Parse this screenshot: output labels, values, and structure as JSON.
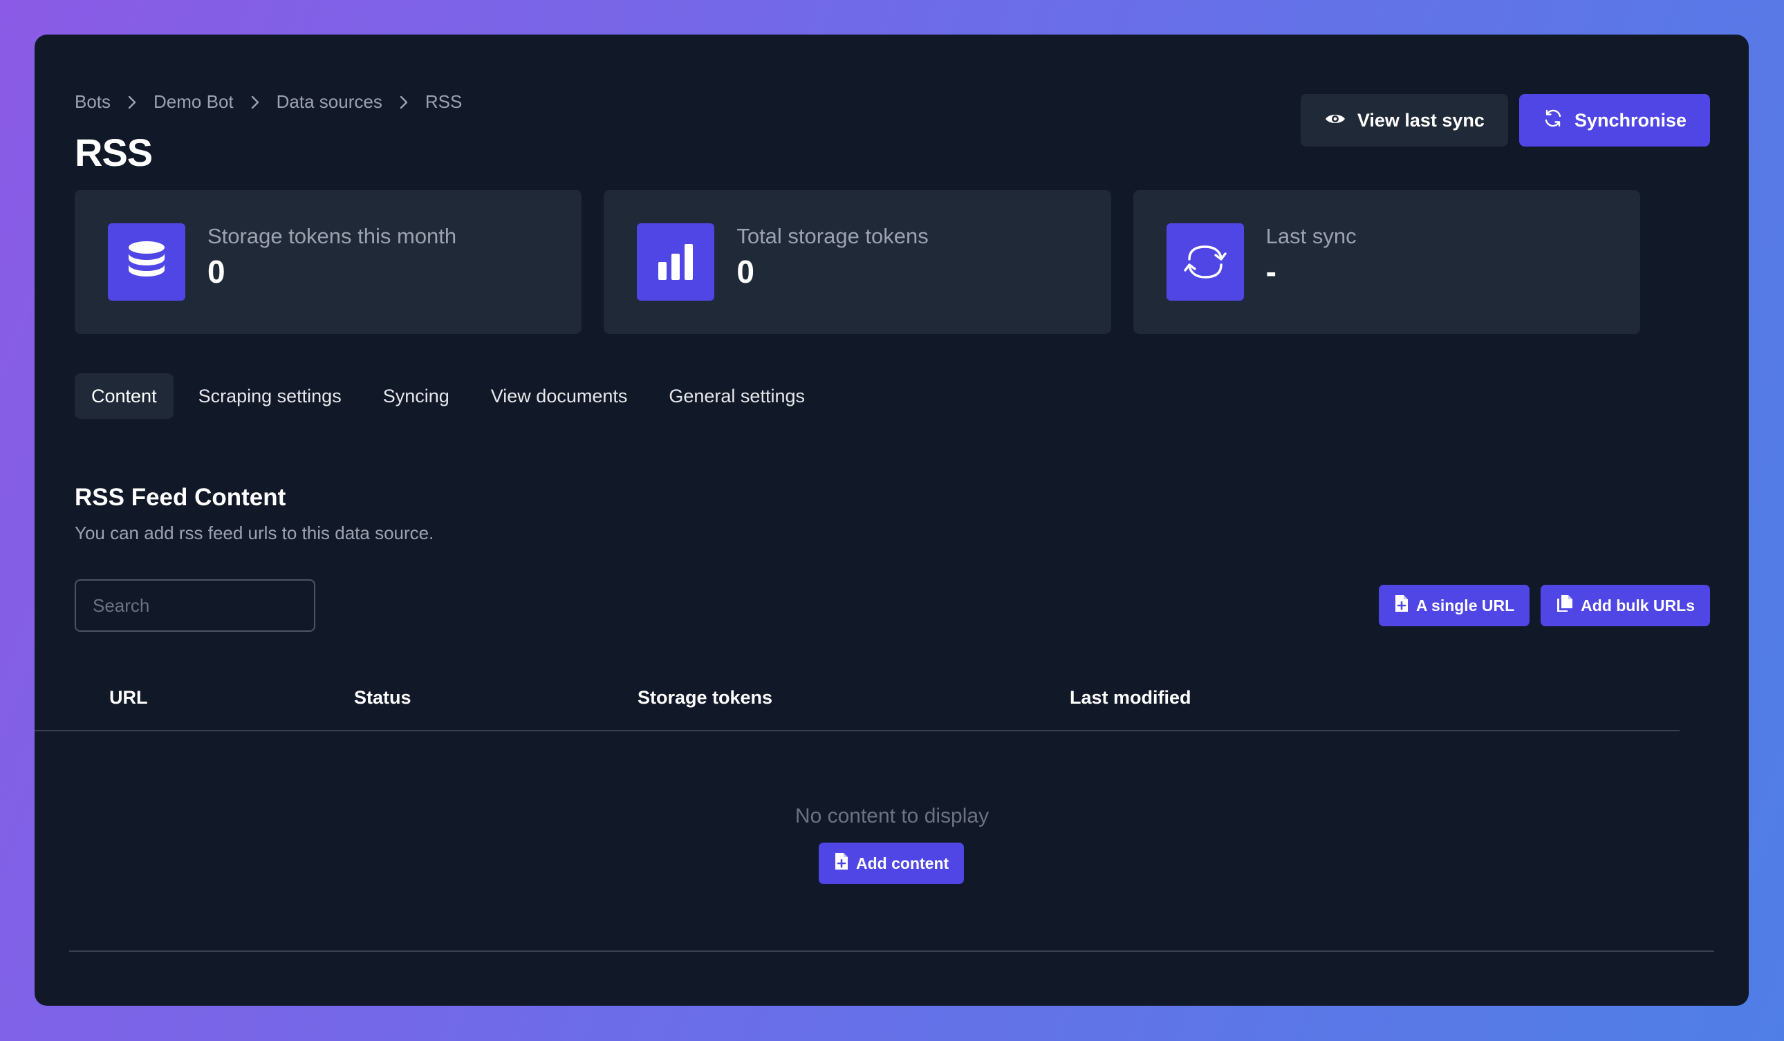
{
  "breadcrumb": [
    {
      "label": "Bots"
    },
    {
      "label": "Demo Bot"
    },
    {
      "label": "Data sources"
    },
    {
      "label": "RSS"
    }
  ],
  "page": {
    "title": "RSS"
  },
  "actions": {
    "view_last_sync": {
      "label": "View last sync",
      "icon": "eye-icon"
    },
    "synchronise": {
      "label": "Synchronise",
      "icon": "refresh-icon"
    }
  },
  "stats": [
    {
      "label": "Storage tokens this month",
      "value": "0",
      "icon": "database-icon"
    },
    {
      "label": "Total storage tokens",
      "value": "0",
      "icon": "bar-chart-icon"
    },
    {
      "label": "Last sync",
      "value": "-",
      "icon": "sync-icon"
    }
  ],
  "tabs": [
    {
      "label": "Content",
      "active": true
    },
    {
      "label": "Scraping settings",
      "active": false
    },
    {
      "label": "Syncing",
      "active": false
    },
    {
      "label": "View documents",
      "active": false
    },
    {
      "label": "General settings",
      "active": false
    }
  ],
  "section": {
    "title": "RSS Feed Content",
    "description": "You can add rss feed urls to this data source."
  },
  "search": {
    "placeholder": "Search",
    "value": ""
  },
  "url_actions": {
    "single_url": {
      "label": "A single URL",
      "icon": "file-plus-icon"
    },
    "bulk_urls": {
      "label": "Add bulk URLs",
      "icon": "files-icon"
    }
  },
  "table": {
    "columns": [
      "URL",
      "Status",
      "Storage tokens",
      "Last modified"
    ],
    "rows": []
  },
  "empty_state": {
    "message": "No content to display",
    "button_label": "Add content"
  },
  "colors": {
    "accent": "#4f46e5",
    "panel_bg": "#111827",
    "card_bg": "#1f2937",
    "muted_text": "#9ca3af"
  }
}
